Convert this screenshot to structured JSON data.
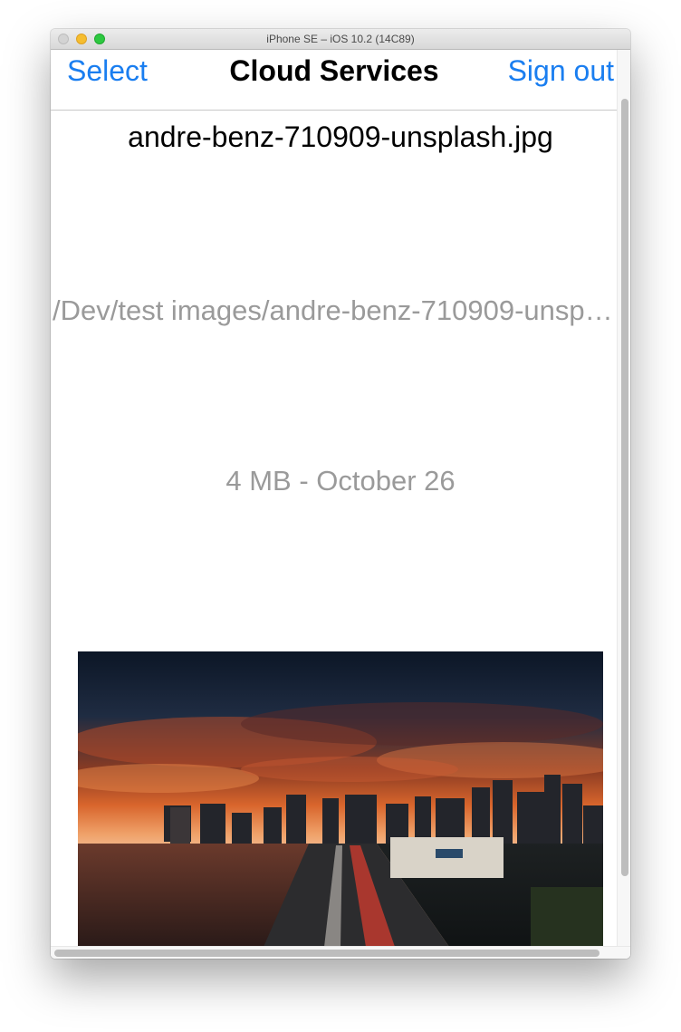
{
  "window": {
    "title": "iPhone SE – iOS 10.2 (14C89)"
  },
  "navbar": {
    "left_button": "Select",
    "title": "Cloud Services",
    "right_button": "Sign out"
  },
  "file": {
    "name": "andre-benz-710909-unsplash.jpg",
    "path": "/Dev/test images/andre-benz-710909-unsplash.jpg",
    "meta": "4 MB - October 26"
  },
  "colors": {
    "accent": "#1a7ef0",
    "secondary_text": "#9a9a9a"
  }
}
